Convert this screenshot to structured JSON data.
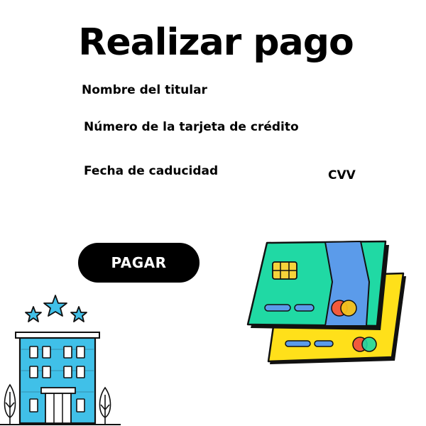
{
  "page": {
    "title": "Realizar pago"
  },
  "form": {
    "cardholder_name_label": "Nombre del titular",
    "card_number_label": "Número de la tarjeta de crédito",
    "expiry_date_label": "Fecha de caducidad",
    "cvv_label": "CVV",
    "cardholder_name_value": "",
    "card_number_value": "",
    "expiry_date_value": "",
    "cvv_value": ""
  },
  "actions": {
    "pay_label": "PAGAR"
  },
  "illustrations": {
    "cards_icon": "credit-cards-icon",
    "hotel_icon": "hotel-building-icon",
    "stars_rating": 3
  },
  "colors": {
    "button_bg": "#000000",
    "button_text": "#ffffff",
    "card_green": "#20d9a4",
    "card_blue": "#5b9bea",
    "card_yellow": "#ffe01a",
    "chip_gold": "#f6d33a",
    "hotel_blue": "#40c0e8",
    "mastercard_red": "#f25a3c",
    "mastercard_orange": "#f6c21a"
  }
}
